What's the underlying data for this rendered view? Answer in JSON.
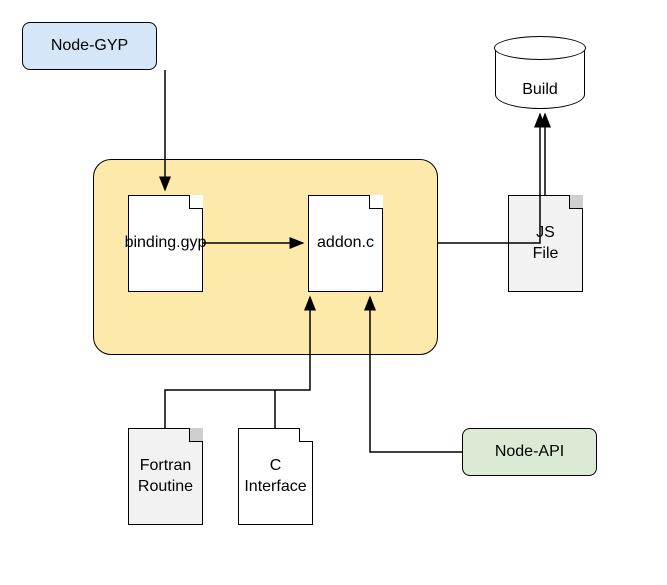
{
  "diagram": {
    "nodes": {
      "node_gyp": {
        "label": "Node-GYP"
      },
      "build": {
        "label": "Build"
      },
      "binding_gyp": {
        "label": "binding.gyp"
      },
      "addon_c": {
        "label": "addon.c"
      },
      "js_file": {
        "label": "JS\nFile"
      },
      "fortran_routine": {
        "label": "Fortran\nRoutine"
      },
      "c_interface": {
        "label": "C\nInterface"
      },
      "node_api": {
        "label": "Node-API"
      }
    },
    "edges": [
      {
        "from": "node_gyp",
        "to": "binding_gyp"
      },
      {
        "from": "binding_gyp",
        "to": "addon_c"
      },
      {
        "from": "fortran_routine",
        "to": "addon_c",
        "via": "under-addon"
      },
      {
        "from": "c_interface",
        "to": "addon_c"
      },
      {
        "from": "node_api",
        "to": "addon_c",
        "via": "right-up"
      },
      {
        "from": "container",
        "to": "build"
      },
      {
        "from": "js_file",
        "to": "build"
      }
    ],
    "container": {
      "contains": [
        "binding_gyp",
        "addon_c"
      ]
    }
  }
}
